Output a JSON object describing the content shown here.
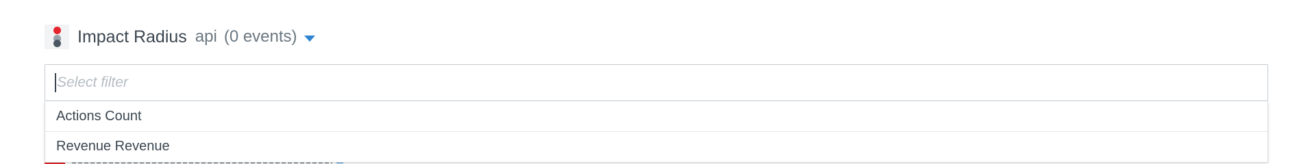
{
  "header": {
    "title": "Impact Radius",
    "subtitle": "api",
    "events": "(0 events)",
    "icon": "traffic-light-icon",
    "dropdown_icon": "caret-down-icon"
  },
  "filter": {
    "placeholder": "Select filter",
    "value": ""
  },
  "dropdown": {
    "items": [
      {
        "label": "Actions Count"
      },
      {
        "label": "Revenue Revenue"
      }
    ]
  },
  "colors": {
    "accent": "#2f84d1",
    "brand_red": "#e5242e",
    "text": "#3b4650",
    "muted": "#6b7781"
  }
}
